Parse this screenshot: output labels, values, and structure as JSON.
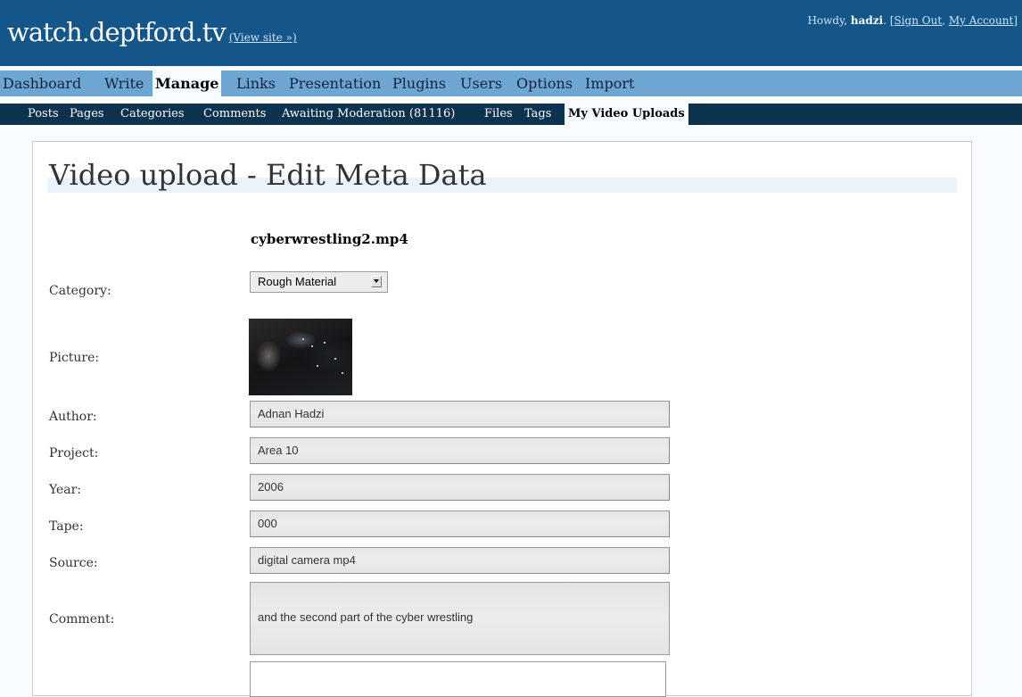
{
  "header": {
    "site_title": "watch.deptford.tv",
    "view_site": "(View site »)",
    "howdy": "Howdy, ",
    "username": "hadzi",
    "after_user": ". [",
    "sign_out": "Sign Out",
    "sep": ", ",
    "my_account": "My Account",
    "close": "]"
  },
  "menu": [
    "Dashboard",
    "Write",
    "Manage",
    "Links",
    "Presentation",
    "Plugins",
    "Users",
    "Options",
    "Import"
  ],
  "menu_current": "Manage",
  "submenu": [
    "Posts",
    "Pages",
    "Categories",
    "Comments",
    "Awaiting Moderation (81116)",
    "Files",
    "Tags",
    "My Video Uploads"
  ],
  "submenu_current": "My Video Uploads",
  "page": {
    "title": "Video upload - Edit Meta Data",
    "filename": "cyberwrestling2.mp4"
  },
  "form": {
    "category_label": "Category:",
    "category_value": "Rough Material",
    "picture_label": "Picture:",
    "author_label": "Author:",
    "author_value": "Adnan Hadzi",
    "project_label": "Project:",
    "project_value": "Area 10",
    "year_label": "Year:",
    "year_value": "2006",
    "tape_label": "Tape:",
    "tape_value": "000",
    "source_label": "Source:",
    "source_value": "digital camera mp4",
    "comment_label": "Comment:",
    "comment_value": "and the second part of the cyber wrestling"
  },
  "colors": {
    "header_bg": "#14568a",
    "menu_bg": "#6da6d1",
    "submenu_bg": "#0d324f",
    "page_bg": "#f9fcfe"
  }
}
